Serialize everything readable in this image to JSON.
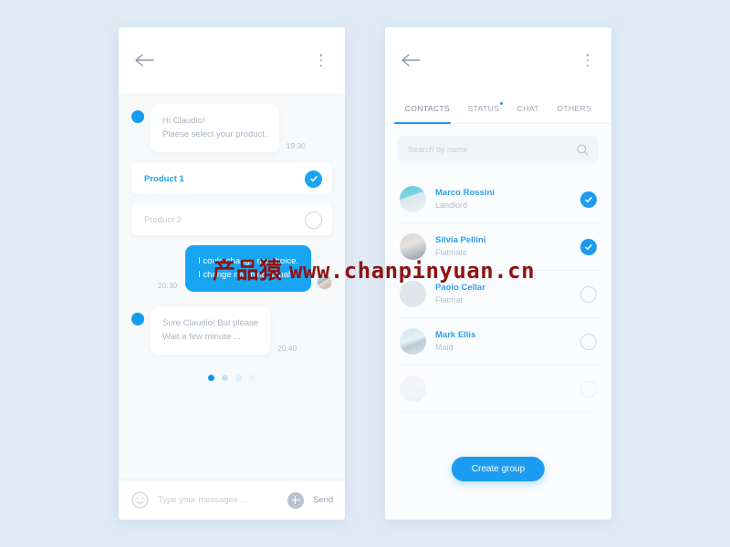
{
  "background_color": "#dfeaf5",
  "accent_color": "#17a5f2",
  "chat_screen": {
    "back_icon": "back-arrow-icon",
    "menu_icon": "kebab-menu-icon",
    "messages": [
      {
        "direction": "incoming",
        "line1": "Hi Claudio!",
        "line2": "Plaese select your product.",
        "time": "19:30"
      },
      {
        "direction": "outgoing",
        "line1": "I could change my choice.",
        "line2": "I change my mind hahah",
        "time": "20:30"
      },
      {
        "direction": "incoming",
        "line1": "Sure Claudio! But please",
        "line2": "Wait a few minute ...",
        "time": "20:40"
      }
    ],
    "options": [
      {
        "label": "Product 1",
        "selected": true
      },
      {
        "label": "Product 2",
        "selected": false
      }
    ],
    "pager": {
      "count": 4,
      "active_index": 0
    },
    "composer": {
      "emoji_icon": "smiley-icon",
      "placeholder": "Type your messages ...",
      "value": "",
      "attach_icon": "plus-icon",
      "send_label": "Send"
    }
  },
  "contacts_screen": {
    "back_icon": "back-arrow-icon",
    "menu_icon": "kebab-menu-icon",
    "tabs": [
      {
        "label": "CONTACTS",
        "active": true,
        "badge": false
      },
      {
        "label": "STATUS",
        "active": false,
        "badge": true
      },
      {
        "label": "CHAT",
        "active": false,
        "badge": false
      },
      {
        "label": "OTHERS",
        "active": false,
        "badge": false
      }
    ],
    "search": {
      "placeholder": "Search by name",
      "value": "",
      "icon": "search-icon"
    },
    "contacts": [
      {
        "name": "Marco Rossini",
        "role": "Landlord",
        "selected": true
      },
      {
        "name": "Silvia Pellini",
        "role": "Flatmate",
        "selected": true
      },
      {
        "name": "Paolo Cellar",
        "role": "Flatmat",
        "selected": false
      },
      {
        "name": "Mark Ellis",
        "role": "Maid",
        "selected": false
      }
    ],
    "create_group_label": "Create group"
  },
  "watermark": {
    "cn": "产品猿",
    "url": "www.chanpinyuan.cn"
  }
}
